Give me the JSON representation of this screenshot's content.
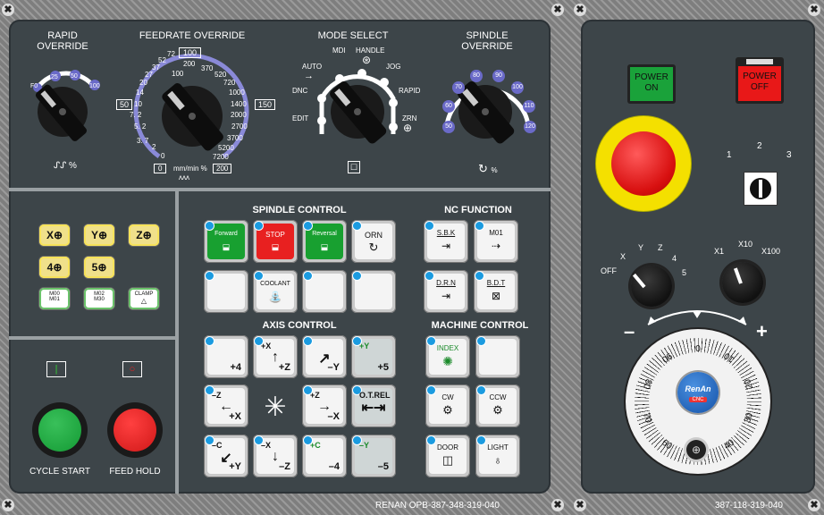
{
  "top": {
    "rapid": {
      "title": "RAPID\nOVERRIDE",
      "ticks": [
        "F0",
        "25",
        "50",
        "100"
      ],
      "unit": "%"
    },
    "feed": {
      "title": "FEEDRATE OVERRIDE",
      "ticks": [
        "0",
        "2",
        "3. 7",
        "5. 2",
        "7. 2",
        "10",
        "14",
        "20",
        "27",
        "37",
        "52",
        "72",
        "100",
        "200",
        "370",
        "520",
        "720",
        "1000",
        "1400",
        "2000",
        "2700",
        "3700",
        "5200",
        "7200"
      ],
      "box_top": "100",
      "box_left": "50",
      "box_right": "150",
      "box_bottom_left": "0",
      "box_bottom_right": "200",
      "unit": "mm/min %"
    },
    "mode": {
      "title": "MODE SELECT",
      "items": [
        "AUTO",
        "MDI",
        "HANDLE",
        "JOG",
        "DNC",
        "RAPID",
        "EDIT",
        "ZRN"
      ]
    },
    "spindle": {
      "title": "SPINDLE\nOVERRIDE",
      "ticks": [
        "50",
        "60",
        "70",
        "80",
        "90",
        "100",
        "110",
        "120"
      ],
      "unit": "%"
    }
  },
  "axis_select": {
    "keys": [
      "X",
      "Y",
      "Z",
      "4",
      "5"
    ],
    "m_keys": [
      "M00\nM01",
      "M02\nM30",
      "CLAMP"
    ]
  },
  "cycle": {
    "start": "CYCLE START",
    "hold": "FEED HOLD"
  },
  "spindle_control": {
    "title": "SPINDLE CONTROL",
    "forward": "Forward",
    "stop": "STOP",
    "reversal": "Reversal",
    "orn": "ORN",
    "coolant": "COOLANT"
  },
  "nc_function": {
    "title": "NC FUNCTION",
    "keys": [
      "S.B.K",
      "M01",
      "D.R.N",
      "B.D.T"
    ]
  },
  "axis_control": {
    "title": "AXIS CONTROL",
    "keys": [
      {
        "t": "",
        "b": "+4"
      },
      {
        "t": "+X",
        "b": "+Z"
      },
      {
        "t": "",
        "b": "–Y"
      },
      {
        "t": "+Y",
        "b": "+5"
      },
      {
        "t": "–Z",
        "b": "+X"
      },
      {
        "t": "",
        "b": ""
      },
      {
        "t": "+Z",
        "b": "–X"
      },
      {
        "t": "O.T.REL",
        "b": ""
      },
      {
        "t": "–C",
        "b": "+Y"
      },
      {
        "t": "–X",
        "b": "–Z"
      },
      {
        "t": "+C",
        "b": "–4"
      },
      {
        "t": "–Y",
        "b": "–5"
      }
    ]
  },
  "machine_control": {
    "title": "MACHINE CONTROL",
    "keys": [
      "INDEX",
      "",
      "CW",
      "CCW",
      "DOOR",
      "LIGHT"
    ]
  },
  "right": {
    "power_on": "POWER\nON",
    "power_off": "POWER\nOFF",
    "key_switch": [
      "1",
      "2",
      "3"
    ],
    "axis_sel": [
      "OFF",
      "X",
      "Y",
      "Z",
      "4",
      "5"
    ],
    "mult": [
      "X1",
      "X10",
      "X100"
    ],
    "mpg_ticks": [
      "0",
      "10",
      "20",
      "30",
      "40",
      "50",
      "60",
      "70",
      "80",
      "90"
    ],
    "mpg_brand": "RenAn",
    "mpg_sub": "CNC",
    "minus": "–",
    "plus": "+"
  },
  "footer": {
    "left_code": "RENAN OPB-387-348-319-040",
    "right_code": "387-118-319-040"
  }
}
